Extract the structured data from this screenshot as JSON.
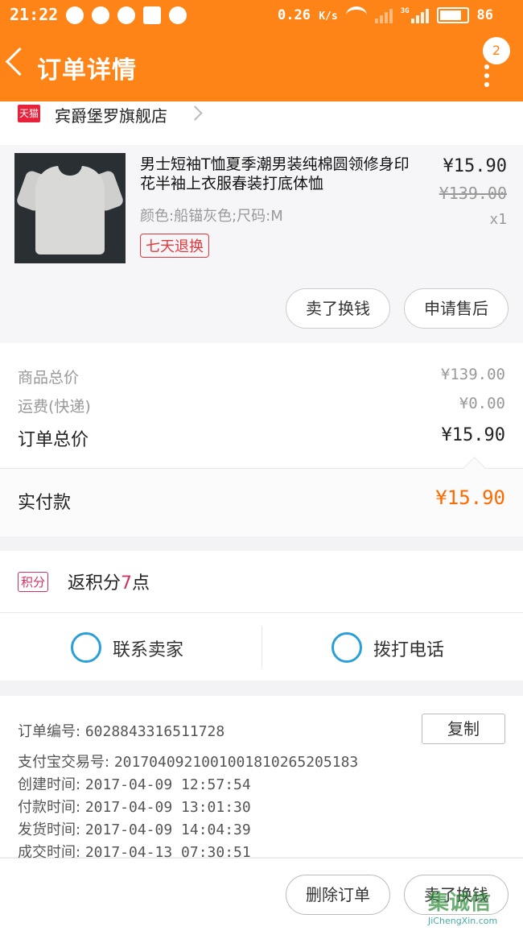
{
  "status_bar": {
    "time": "21:22",
    "speed": "0.26",
    "speed_unit": "K/s",
    "network": "3G",
    "battery": "86"
  },
  "header": {
    "title": "订单详情",
    "badge": "2"
  },
  "shop": {
    "tag": "天猫",
    "name": "宾爵堡罗旗舰店"
  },
  "product": {
    "title": "男士短袖T恤夏季潮男装纯棉圆领修身印花半袖上衣服春装打底体恤",
    "spec": "颜色:船锚灰色;尺码:M",
    "return_tag": "七天退换",
    "price": "¥15.90",
    "original_price": "¥139.00",
    "quantity": "x1",
    "buttons": [
      "卖了换钱",
      "申请售后"
    ]
  },
  "totals": {
    "goods_label": "商品总价",
    "goods_value": "¥139.00",
    "shipping_label": "运费(快递)",
    "shipping_value": "¥0.00",
    "order_label": "订单总价",
    "order_value": "¥15.90",
    "paid_label": "实付款",
    "paid_value": "¥15.90"
  },
  "points": {
    "tag": "积分",
    "prefix": "返积分",
    "count": "7",
    "suffix": "点"
  },
  "contact": {
    "seller": "联系卖家",
    "call": "拨打电话"
  },
  "order_info": {
    "number_label": "订单编号:",
    "number": "6028843316511728",
    "copy": "复制",
    "alipay_label": "支付宝交易号:",
    "alipay": "2017040921001001810265205183",
    "created_label": "创建时间:",
    "created": "2017-04-09 12:57:54",
    "paid_label": "付款时间:",
    "paid": "2017-04-09 13:01:30",
    "shipped_label": "发货时间:",
    "shipped": "2017-04-09 14:04:39",
    "done_label": "成交时间:",
    "done": "2017-04-13 07:30:51"
  },
  "footer": {
    "delete": "删除订单",
    "sell": "卖了换钱"
  },
  "watermark": {
    "text": "集诚信",
    "url": "JiChengXin.com"
  },
  "colors": {
    "brand": "#ff8417",
    "paid": "#ff6a00",
    "tmall": "#e8223b",
    "points": "#d33060",
    "icon": "#2a9fd8"
  }
}
